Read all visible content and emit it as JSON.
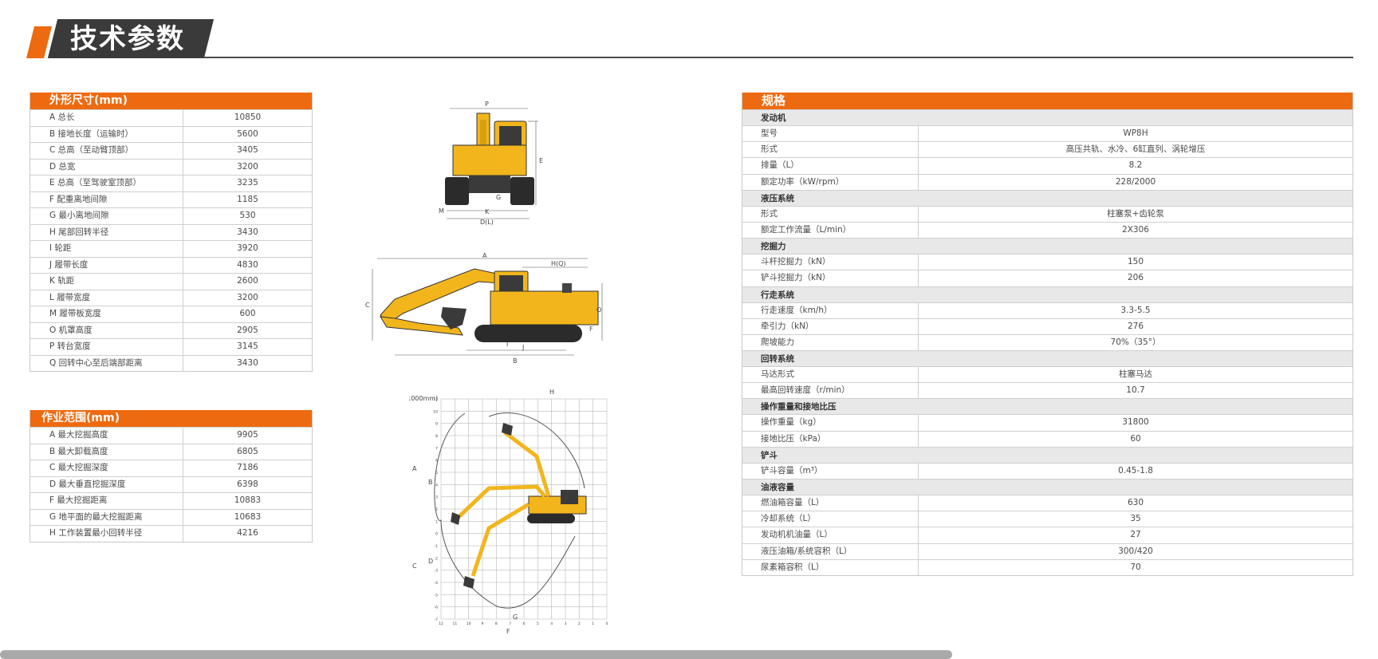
{
  "header": {
    "title": "技术参数"
  },
  "dims": {
    "title": "外形尺寸(mm)",
    "rows": [
      {
        "label": "A  总长",
        "value": "10850"
      },
      {
        "label": "B  接地长度（运输时）",
        "value": "5600"
      },
      {
        "label": "C  总高（至动臂顶部）",
        "value": "3405"
      },
      {
        "label": "D  总宽",
        "value": "3200"
      },
      {
        "label": "E  总高（至驾驶室顶部）",
        "value": "3235"
      },
      {
        "label": "F  配重离地间隙",
        "value": "1185"
      },
      {
        "label": "G  最小离地间隙",
        "value": "530"
      },
      {
        "label": "H  尾部回转半径",
        "value": "3430"
      },
      {
        "label": "I   轮距",
        "value": "3920"
      },
      {
        "label": "J   履带长度",
        "value": "4830"
      },
      {
        "label": "K  轨距",
        "value": "2600"
      },
      {
        "label": "L  履带宽度",
        "value": "3200"
      },
      {
        "label": "M  履带板宽度",
        "value": "600"
      },
      {
        "label": "O  机罩高度",
        "value": "2905"
      },
      {
        "label": "P  转台宽度",
        "value": "3145"
      },
      {
        "label": "Q  回转中心至后端部距离",
        "value": "3430"
      }
    ]
  },
  "work": {
    "title": "作业范围(mm)",
    "rows": [
      {
        "label": "A  最大挖掘高度",
        "value": "9905"
      },
      {
        "label": "B  最大卸载高度",
        "value": "6805"
      },
      {
        "label": "C  最大挖掘深度",
        "value": "7186"
      },
      {
        "label": "D  最大垂直挖掘深度",
        "value": "6398"
      },
      {
        "label": "F  最大挖掘距离",
        "value": "10883"
      },
      {
        "label": "G  地平面的最大挖掘距离",
        "value": "10683"
      },
      {
        "label": "H  工作装置最小回转半径",
        "value": "4216"
      }
    ]
  },
  "spec": {
    "title": "规格",
    "sections": [
      {
        "name": "发动机",
        "rows": [
          {
            "label": "型号",
            "value": "WP8H"
          },
          {
            "label": "形式",
            "value": "高压共轨、水冷、6缸直列、涡轮增压"
          },
          {
            "label": "排量（L）",
            "value": "8.2"
          },
          {
            "label": "额定功率（kW/rpm）",
            "value": "228/2000"
          }
        ]
      },
      {
        "name": "液压系统",
        "rows": [
          {
            "label": "形式",
            "value": "柱塞泵+齿轮泵"
          },
          {
            "label": "额定工作流量（L/min）",
            "value": "2X306"
          }
        ]
      },
      {
        "name": "挖掘力",
        "rows": [
          {
            "label": "斗杆挖掘力（kN）",
            "value": "150"
          },
          {
            "label": "铲斗挖掘力（kN）",
            "value": "206"
          }
        ]
      },
      {
        "name": "行走系统",
        "rows": [
          {
            "label": "行走速度（km/h）",
            "value": "3.3-5.5"
          },
          {
            "label": "牵引力（kN）",
            "value": "276"
          },
          {
            "label": "爬坡能力",
            "value": "70%（35°）"
          }
        ]
      },
      {
        "name": "回转系统",
        "rows": [
          {
            "label": "马达形式",
            "value": "柱塞马达"
          },
          {
            "label": "最高回转速度（r/min）",
            "value": "10.7"
          }
        ]
      },
      {
        "name": "操作重量和接地比压",
        "rows": [
          {
            "label": "操作重量（kg）",
            "value": "31800"
          },
          {
            "label": "接地比压（kPa）",
            "value": "60"
          }
        ]
      },
      {
        "name": "铲斗",
        "rows": [
          {
            "label": "铲斗容量（m³）",
            "value": "0.45-1.8"
          }
        ]
      },
      {
        "name": "油液容量",
        "rows": [
          {
            "label": "燃油箱容量（L）",
            "value": "630"
          },
          {
            "label": "冷却系统（L）",
            "value": "35"
          },
          {
            "label": "发动机机油量（L）",
            "value": "27"
          },
          {
            "label": "液压油箱/系统容积（L）",
            "value": "300/420"
          },
          {
            "label": "尿素箱容积（L）",
            "value": "70"
          }
        ]
      }
    ]
  },
  "drawings": {
    "front_labels": [
      "P",
      "E",
      "G",
      "M",
      "K",
      "D(L)"
    ],
    "side_labels": [
      "A",
      "H(Q)",
      "C",
      "O",
      "F",
      "J",
      "I",
      "B"
    ],
    "range_labels": [
      "H",
      "A",
      "B",
      "C",
      "D",
      "G",
      "F"
    ],
    "range_unit": "(1000mm)",
    "y_ticks": [
      "11",
      "10",
      "9",
      "8",
      "7",
      "6",
      "5",
      "4",
      "3",
      "2",
      "1",
      "0",
      "-1",
      "-2",
      "-3",
      "-4",
      "-5",
      "-6",
      "-7"
    ],
    "x_ticks": [
      "12",
      "11",
      "10",
      "9",
      "8",
      "7",
      "6",
      "5",
      "4",
      "3",
      "2",
      "1",
      "0"
    ]
  },
  "colors": {
    "accent": "#ee6a10",
    "machine": "#f2b61c",
    "dark": "#3a3a3a"
  }
}
